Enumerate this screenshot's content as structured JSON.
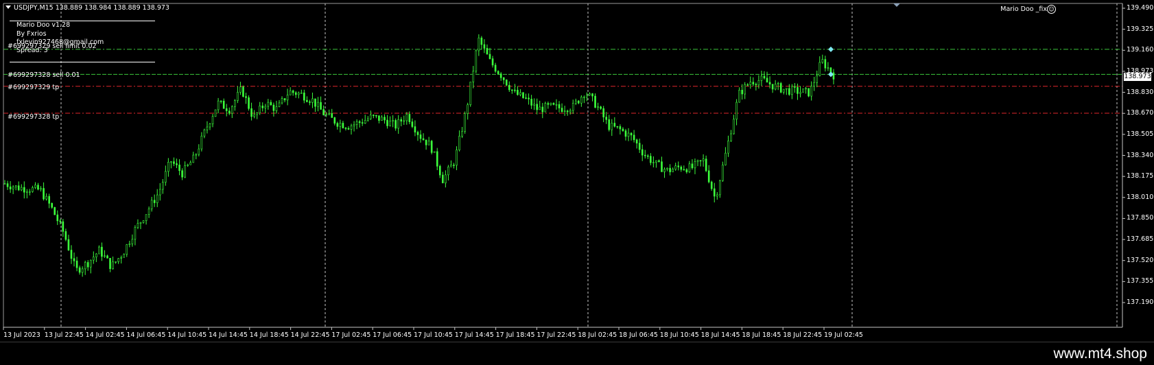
{
  "header": {
    "symbol_info": "USDJPY,M15  138.889 138.984 138.889 138.973",
    "ea_name": "Mario Doo _fix",
    "smiley": "☺"
  },
  "info_panel": {
    "title": "Mario Doo v1.28",
    "author": "By Fxrios",
    "email": "fxlevin927468@gmail.com",
    "spread": "Spread: 3"
  },
  "orders": [
    {
      "label": "#699297329 sell limit 0.02",
      "price": 139.169,
      "color": "#3cc83c"
    },
    {
      "label": "#699297328 sell 0.01",
      "price": 138.973,
      "color": "#3cc83c"
    },
    {
      "label": "#699297329 tp",
      "price": 138.88,
      "color": "#e0262c"
    },
    {
      "label": "#699297328 tp",
      "price": 138.67,
      "color": "#e0262c"
    }
  ],
  "price_axis": {
    "labels": [
      "139.490",
      "139.325",
      "139.160",
      "138.973",
      "138.830",
      "138.670",
      "138.505",
      "138.340",
      "138.175",
      "138.010",
      "137.850",
      "137.685",
      "137.520",
      "137.355",
      "137.190"
    ],
    "current_price": "138.973"
  },
  "time_axis": {
    "labels": [
      "13 Jul 2023",
      "13 Jul 22:45",
      "14 Jul 02:45",
      "14 Jul 06:45",
      "14 Jul 10:45",
      "14 Jul 14:45",
      "14 Jul 18:45",
      "14 Jul 22:45",
      "17 Jul 02:45",
      "17 Jul 06:45",
      "17 Jul 10:45",
      "17 Jul 14:45",
      "17 Jul 18:45",
      "17 Jul 22:45",
      "18 Jul 02:45",
      "18 Jul 06:45",
      "18 Jul 10:45",
      "18 Jul 14:45",
      "18 Jul 18:45",
      "18 Jul 22:45",
      "19 Jul 02:45"
    ]
  },
  "colors": {
    "candle": "#3cff3c",
    "grid": "#c8c8c8",
    "background": "#000000"
  },
  "chart_data": {
    "type": "line",
    "series": [
      {
        "values": [
          138.12,
          138.09,
          138.08,
          138.07,
          137.92,
          137.73,
          137.44,
          137.5,
          137.6,
          137.47,
          137.58,
          137.76,
          137.9,
          138.05,
          138.3,
          138.2,
          138.32,
          138.55,
          138.75,
          138.7,
          138.86,
          138.63,
          138.75,
          138.7,
          138.84,
          138.82,
          138.77,
          138.66,
          138.6,
          138.57,
          138.6,
          138.64,
          138.62,
          138.57,
          138.66,
          138.5,
          138.41,
          138.15,
          138.3,
          138.7,
          139.25,
          139.07,
          138.96,
          138.83,
          138.78,
          138.7,
          138.72,
          138.71,
          138.72,
          138.84,
          138.73,
          138.57,
          138.54,
          138.48,
          138.35,
          138.27,
          138.22,
          138.25,
          138.24,
          138.3,
          138.0,
          138.4,
          138.82,
          138.92,
          138.93,
          138.88,
          138.85,
          138.84,
          138.83,
          139.08,
          138.97
        ]
      }
    ],
    "ylim": [
      137.19,
      139.49
    ]
  }
}
